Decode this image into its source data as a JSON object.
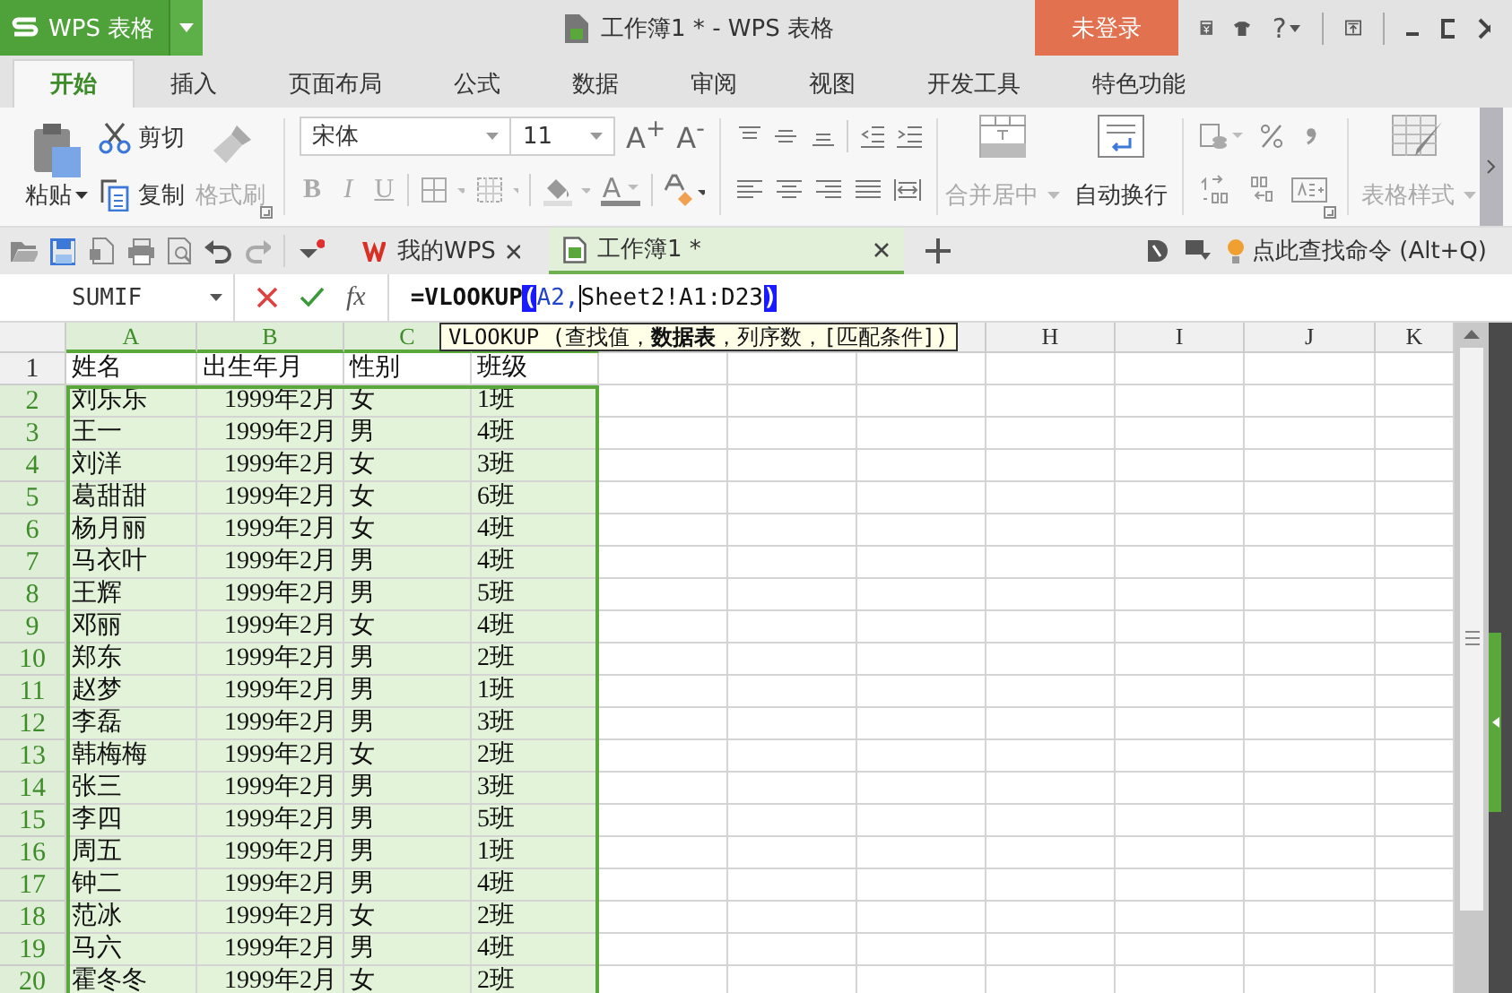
{
  "app_button": {
    "label": "WPS 表格"
  },
  "window": {
    "title": "工作簿1 * - WPS 表格"
  },
  "login_button": "未登录",
  "help": "?",
  "menu_tabs": [
    {
      "label": "开始",
      "selected": true
    },
    {
      "label": "插入",
      "selected": false
    },
    {
      "label": "页面布局",
      "selected": false
    },
    {
      "label": "公式",
      "selected": false
    },
    {
      "label": "数据",
      "selected": false
    },
    {
      "label": "审阅",
      "selected": false
    },
    {
      "label": "视图",
      "selected": false
    },
    {
      "label": "开发工具",
      "selected": false
    },
    {
      "label": "特色功能",
      "selected": false
    }
  ],
  "ribbon": {
    "clipboard": [
      {
        "label": "粘贴",
        "kind": "paste",
        "disabled": false
      },
      {
        "label": "剪切",
        "kind": "cut",
        "disabled": false
      },
      {
        "label": "复制",
        "kind": "copy",
        "disabled": false
      },
      {
        "label": "格式刷",
        "kind": "brush",
        "disabled": true
      }
    ],
    "font": {
      "name": "宋体",
      "size": "11",
      "grow": "A$^{+}$",
      "shrink": "A$^{-}$",
      "font_color": "A"
    },
    "style_buttons": [
      {
        "label": "B",
        "kind": "bold",
        "disabled": true
      },
      {
        "label": "I",
        "kind": "italic",
        "disabled": true
      },
      {
        "label": "U",
        "kind": "underline",
        "disabled": true
      }
    ],
    "large_buttons": [
      {
        "label": "合并居中",
        "kind": "merge",
        "disabled": true
      },
      {
        "label": "自动换行",
        "kind": "wrap",
        "disabled": false
      }
    ],
    "table_style": {
      "label": "表格样式",
      "disabled": true
    }
  },
  "doc_tabs": [
    {
      "label": "我的WPS",
      "kind": "home",
      "selected": false
    },
    {
      "label": "工作簿1 *",
      "kind": "sheet",
      "selected": true
    }
  ],
  "command_search": "点此查找命令 (Alt+Q)",
  "formula_bar": {
    "name_box": "SUMIF",
    "fx": "fx",
    "formula": [
      {
        "text": "=VLOOKUP",
        "kind": "function"
      },
      {
        "text": "(",
        "kind": "highlight"
      },
      {
        "text": "A2,",
        "kind": "reference"
      },
      {
        "text": "Sheet2!A1:D23",
        "kind": "argument"
      },
      {
        "text": ")",
        "kind": "highlight"
      }
    ]
  },
  "tooltip": "VLOOKUP (查找值，**数据表**，列序数，[匹配条件])",
  "columns": [
    {
      "label": "A",
      "selected": true
    },
    {
      "label": "B",
      "selected": true
    },
    {
      "label": "C",
      "selected": true
    },
    {
      "selected": true
    },
    {
      "selected": false
    },
    {
      "selected": false
    },
    {
      "selected": false
    },
    {
      "label": "H",
      "selected": false
    },
    {
      "label": "I",
      "selected": false
    },
    {
      "label": "J",
      "selected": false
    },
    {
      "label": "K",
      "selected": false
    }
  ],
  "rows": [
    {
      "number": "1",
      "kind": "header",
      "selected": false,
      "cells": [
        "姓名",
        "出生年月",
        "性别",
        "班级"
      ]
    },
    {
      "number": "2",
      "kind": "data",
      "selected": true,
      "cells": [
        "刘乐乐",
        "1999年2月",
        "女",
        "1班"
      ]
    },
    {
      "number": "3",
      "kind": "data",
      "selected": true,
      "cells": [
        "王一",
        "1999年2月",
        "男",
        "4班"
      ]
    },
    {
      "number": "4",
      "kind": "data",
      "selected": true,
      "cells": [
        "刘洋",
        "1999年2月",
        "女",
        "3班"
      ]
    },
    {
      "number": "5",
      "kind": "data",
      "selected": true,
      "cells": [
        "葛甜甜",
        "1999年2月",
        "女",
        "6班"
      ]
    },
    {
      "number": "6",
      "kind": "data",
      "selected": true,
      "cells": [
        "杨月丽",
        "1999年2月",
        "女",
        "4班"
      ]
    },
    {
      "number": "7",
      "kind": "data",
      "selected": true,
      "cells": [
        "马衣叶",
        "1999年2月",
        "男",
        "4班"
      ]
    },
    {
      "number": "8",
      "kind": "data",
      "selected": true,
      "cells": [
        "王辉",
        "1999年2月",
        "男",
        "5班"
      ]
    },
    {
      "number": "9",
      "kind": "data",
      "selected": true,
      "cells": [
        "邓丽",
        "1999年2月",
        "女",
        "4班"
      ]
    },
    {
      "number": "10",
      "kind": "data",
      "selected": true,
      "cells": [
        "郑东",
        "1999年2月",
        "男",
        "2班"
      ]
    },
    {
      "number": "11",
      "kind": "data",
      "selected": true,
      "cells": [
        "赵梦",
        "1999年2月",
        "男",
        "1班"
      ]
    },
    {
      "number": "12",
      "kind": "data",
      "selected": true,
      "cells": [
        "李磊",
        "1999年2月",
        "男",
        "3班"
      ]
    },
    {
      "number": "13",
      "kind": "data",
      "selected": true,
      "cells": [
        "韩梅梅",
        "1999年2月",
        "女",
        "2班"
      ]
    },
    {
      "number": "14",
      "kind": "data",
      "selected": true,
      "cells": [
        "张三",
        "1999年2月",
        "男",
        "3班"
      ]
    },
    {
      "number": "15",
      "kind": "data",
      "selected": true,
      "cells": [
        "李四",
        "1999年2月",
        "男",
        "5班"
      ]
    },
    {
      "number": "16",
      "kind": "data",
      "selected": true,
      "cells": [
        "周五",
        "1999年2月",
        "男",
        "1班"
      ]
    },
    {
      "number": "17",
      "kind": "data",
      "selected": true,
      "cells": [
        "钟二",
        "1999年2月",
        "男",
        "4班"
      ]
    },
    {
      "number": "18",
      "kind": "data",
      "selected": true,
      "cells": [
        "范冰",
        "1999年2月",
        "女",
        "2班"
      ]
    },
    {
      "number": "19",
      "kind": "data",
      "selected": true,
      "cells": [
        "马六",
        "1999年2月",
        "男",
        "4班"
      ]
    },
    {
      "number": "20",
      "kind": "data",
      "selected": true,
      "cells": [
        "霍冬冬",
        "1999年2月",
        "女",
        "2班"
      ]
    }
  ]
}
